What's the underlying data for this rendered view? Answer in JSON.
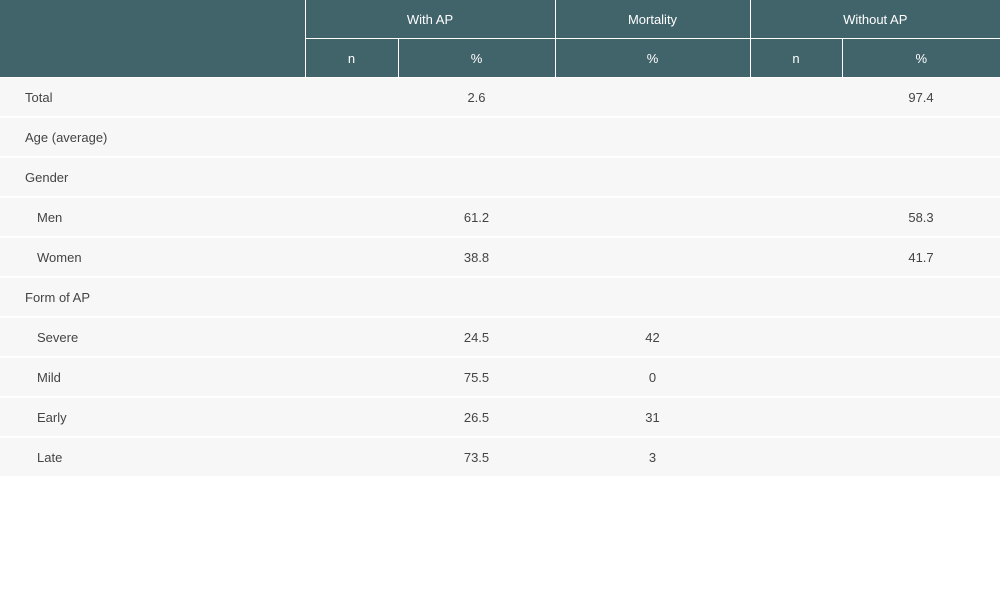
{
  "header": {
    "groups": [
      "",
      "With AP",
      "Mortality",
      "Without AP"
    ],
    "sub": [
      "n",
      "%",
      "%",
      "n",
      "%"
    ]
  },
  "rows": [
    {
      "label": "Total",
      "cells": [
        "",
        "2.6",
        "",
        "",
        "97.4"
      ]
    },
    {
      "label": "Age (average)",
      "cells": [
        "",
        "",
        "",
        "",
        ""
      ]
    },
    {
      "label": "Gender",
      "cells": [
        "",
        "",
        "",
        "",
        ""
      ]
    },
    {
      "label": "Men",
      "cells": [
        "",
        "61.2",
        "",
        "",
        "58.3"
      ]
    },
    {
      "label": "Women",
      "cells": [
        "",
        "38.8",
        "",
        "",
        "41.7"
      ]
    },
    {
      "label": "Form of AP",
      "cells": [
        "",
        "",
        "",
        "",
        ""
      ]
    },
    {
      "label": "Severe",
      "cells": [
        "",
        "24.5",
        "42",
        "",
        ""
      ]
    },
    {
      "label": "Mild",
      "cells": [
        "",
        "75.5",
        "0",
        "",
        ""
      ]
    },
    {
      "label": "Early",
      "cells": [
        "",
        "26.5",
        "31",
        "",
        ""
      ]
    },
    {
      "label": "Late",
      "cells": [
        "",
        "73.5",
        "3",
        "",
        ""
      ]
    }
  ]
}
